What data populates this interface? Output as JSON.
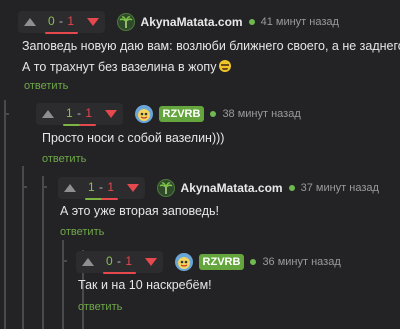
{
  "colors": {
    "background": "#232325",
    "positive": "#8bbf52",
    "negative": "#e5484d",
    "reply": "#6fa84a",
    "badge": "#64a63d"
  },
  "comments": [
    {
      "score_up": "0",
      "score_down": "1",
      "author": "AkynaMatata.com",
      "time": "41 минут назад",
      "lines": [
        "Заповедь новую даю вам: возлюби ближнего своего, а не заднего.",
        "А то трахнут без вазелина в жопу"
      ],
      "emoji": "grimacing-face-emoji",
      "reply_label": "ответить"
    },
    {
      "score_up": "1",
      "score_down": "1",
      "author": "RZVRB",
      "time": "38 минут назад",
      "lines": [
        "Просто носи с собой вазелин)))"
      ],
      "reply_label": "ответить"
    },
    {
      "score_up": "1",
      "score_down": "1",
      "author": "AkynaMatata.com",
      "time": "37 минут назад",
      "lines": [
        "А это уже вторая заповедь!"
      ],
      "reply_label": "ответить"
    },
    {
      "score_up": "0",
      "score_down": "1",
      "author": "RZVRB",
      "time": "36 минут назад",
      "lines": [
        "Так и на 10 наскребём!"
      ],
      "reply_label": "ответить"
    }
  ]
}
